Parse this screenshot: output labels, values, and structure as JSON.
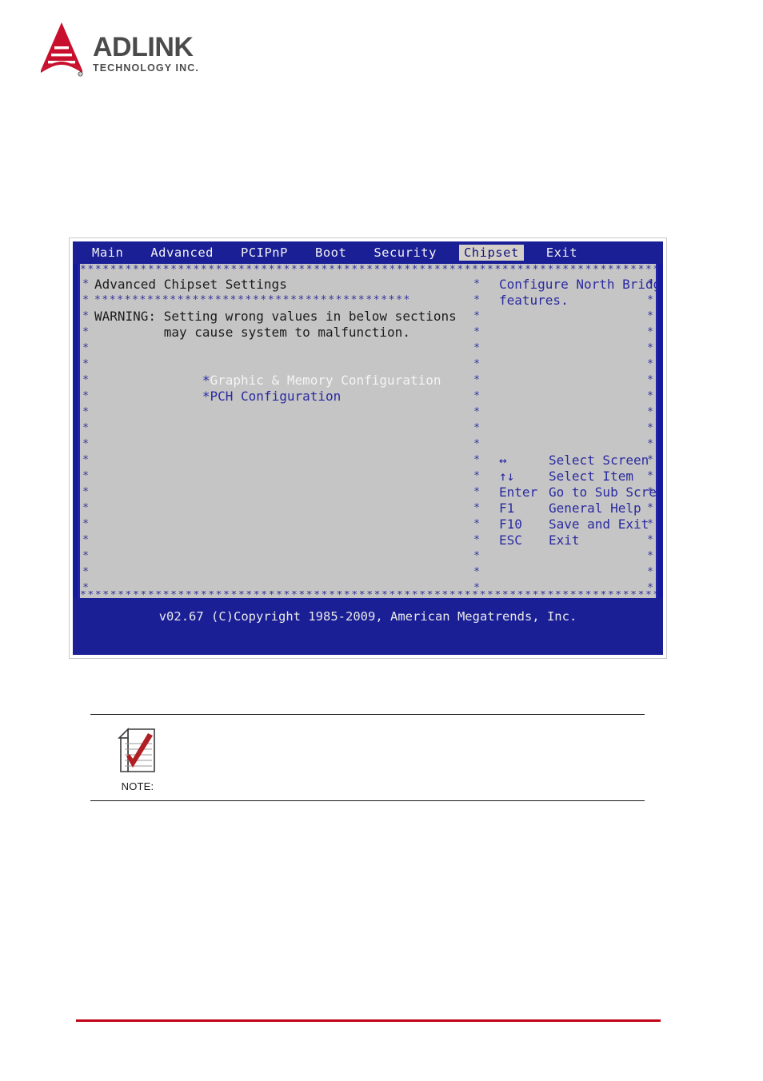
{
  "brand": {
    "name": "ADLINK",
    "tagline": "TECHNOLOGY INC.",
    "logo_icon": "adlink-triangle-logo",
    "logo_color": "#c8102e",
    "wordmark_color": "#4b4b4b"
  },
  "bios": {
    "menu": [
      {
        "label": "Main",
        "active": false
      },
      {
        "label": "Advanced",
        "active": false
      },
      {
        "label": "PCIPnP",
        "active": false
      },
      {
        "label": "Boot",
        "active": false
      },
      {
        "label": "Security",
        "active": false
      },
      {
        "label": "Chipset",
        "active": true
      },
      {
        "label": "Exit",
        "active": false
      }
    ],
    "left_panel": {
      "title": "Advanced Chipset Settings",
      "separator": "******************************************",
      "warning_line1": "WARNING: Setting wrong values in below sections",
      "warning_line2": "         may cause system to malfunction.",
      "items": [
        {
          "bullet": "*",
          "label": "Graphic & Memory Configuration",
          "selected": true
        },
        {
          "bullet": "*",
          "label": "PCH Configuration",
          "selected": false
        }
      ]
    },
    "right_panel": {
      "help_line1": "Configure North Bridge",
      "help_line2": "features.",
      "keys": [
        {
          "key": "↔",
          "action": "Select Screen"
        },
        {
          "key": "↑↓",
          "action": "Select Item"
        },
        {
          "key": "Enter",
          "action": "Go to Sub Screen"
        },
        {
          "key": "F1",
          "action": "General Help"
        },
        {
          "key": "F10",
          "action": "Save and Exit"
        },
        {
          "key": "ESC",
          "action": "Exit"
        }
      ]
    },
    "copyright": "v02.67 (C)Copyright 1985-2009, American Megatrends, Inc.",
    "colors": {
      "screen_blue": "#1a1f96",
      "panel_gray": "#c5c5c5",
      "text_blue": "#2a2aa0",
      "text_dark": "#1c1c1c",
      "highlight_bg": "#d4d0c8"
    }
  },
  "note": {
    "label": "NOTE:",
    "icon": "note-document-check-icon",
    "check_color": "#b01f24",
    "body": ""
  }
}
